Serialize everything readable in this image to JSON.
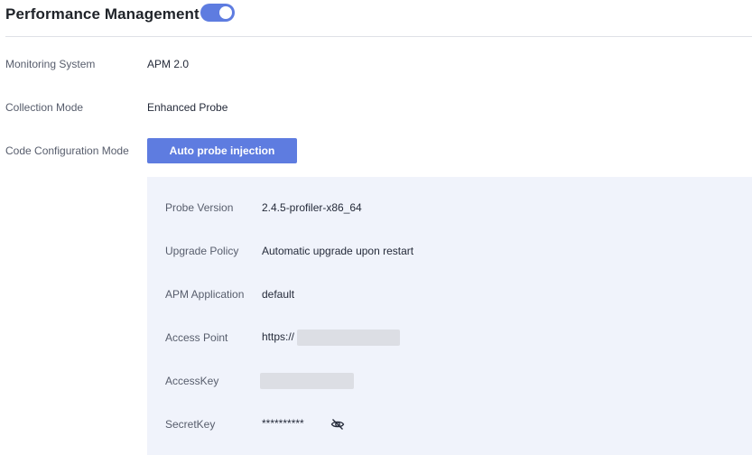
{
  "header": {
    "title": "Performance Management",
    "toggle_on": true
  },
  "settings": {
    "monitoring_system": {
      "label": "Monitoring System",
      "value": "APM 2.0"
    },
    "collection_mode": {
      "label": "Collection Mode",
      "value": "Enhanced Probe"
    },
    "code_config_mode": {
      "label": "Code Configuration Mode",
      "button_label": "Auto probe injection"
    }
  },
  "probe": {
    "version": {
      "label": "Probe Version",
      "value": "2.4.5-profiler-x86_64"
    },
    "upgrade_policy": {
      "label": "Upgrade Policy",
      "value": "Automatic upgrade upon restart"
    },
    "apm_application": {
      "label": "APM Application",
      "value": "default"
    },
    "access_point": {
      "label": "Access Point",
      "value": "https://"
    },
    "access_key": {
      "label": "AccessKey"
    },
    "secret_key": {
      "label": "SecretKey",
      "value": "**********",
      "icon": "eye-off-icon"
    }
  },
  "colors": {
    "accent": "#5e7ce0",
    "panel_bg": "#f0f3fb"
  }
}
